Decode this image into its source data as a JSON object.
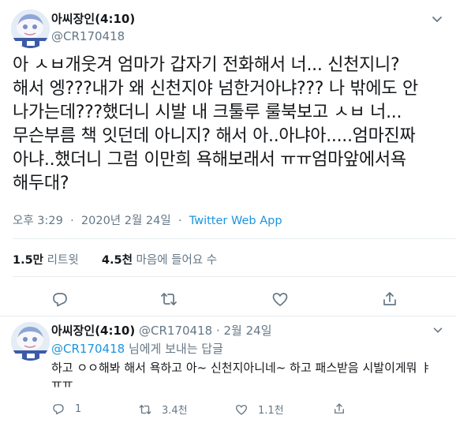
{
  "tweet": {
    "display_name": "아씨장인(4:10)",
    "handle": "@CR170418",
    "text_lines": [
      "아 ㅅㅂ개웃겨 엄마가 갑자기 전화해서 너... 신천지니?",
      "해서 엥???내가 왜 신천지야 넘한거아냐??? 나 밖에도 안",
      "나가는데???했더니 시발 내 크툴루 룰북보고 ㅅㅂ 너...",
      "무슨부름 책 잇던데 아니지? 해서 아..아냐아.....엄마진짜",
      "아냐..했더니 그럼 이만희 욕해보래서 ㅠㅠ엄마앞에서욕",
      "해두대?"
    ],
    "time": "오후 3:29",
    "date": "2020년 2월 24일",
    "separator": " · ",
    "source_app": "Twitter Web App",
    "retweet_count": "1.5만",
    "retweet_label": "리트윗",
    "like_count": "4.5천",
    "like_label": "마음에 들어요 수"
  },
  "reply": {
    "display_name": "아씨장인(4:10)",
    "handle": "@CR170418",
    "separator": " · ",
    "date": "2월 24일",
    "replying_to_mention": "@CR170418",
    "replying_to_suffix": " 님에게 보내는 답글",
    "text_lines": [
      "하고 ㅇㅇ해봐 해서 욕하고 아~ 신천지아니네~ 하고 패스받음 시발이게뭐 ㅑ",
      "ㅠㅠ"
    ],
    "reply_count": "1",
    "retweet_count": "3.4천",
    "like_count": "1.1천"
  },
  "colors": {
    "text": "#14171a",
    "secondary": "#657786",
    "link": "#1b95e0",
    "divider": "#e6ecf0"
  },
  "icons": [
    "avatar",
    "chevron-down-icon",
    "reply-icon",
    "retweet-icon",
    "like-icon",
    "share-icon"
  ]
}
